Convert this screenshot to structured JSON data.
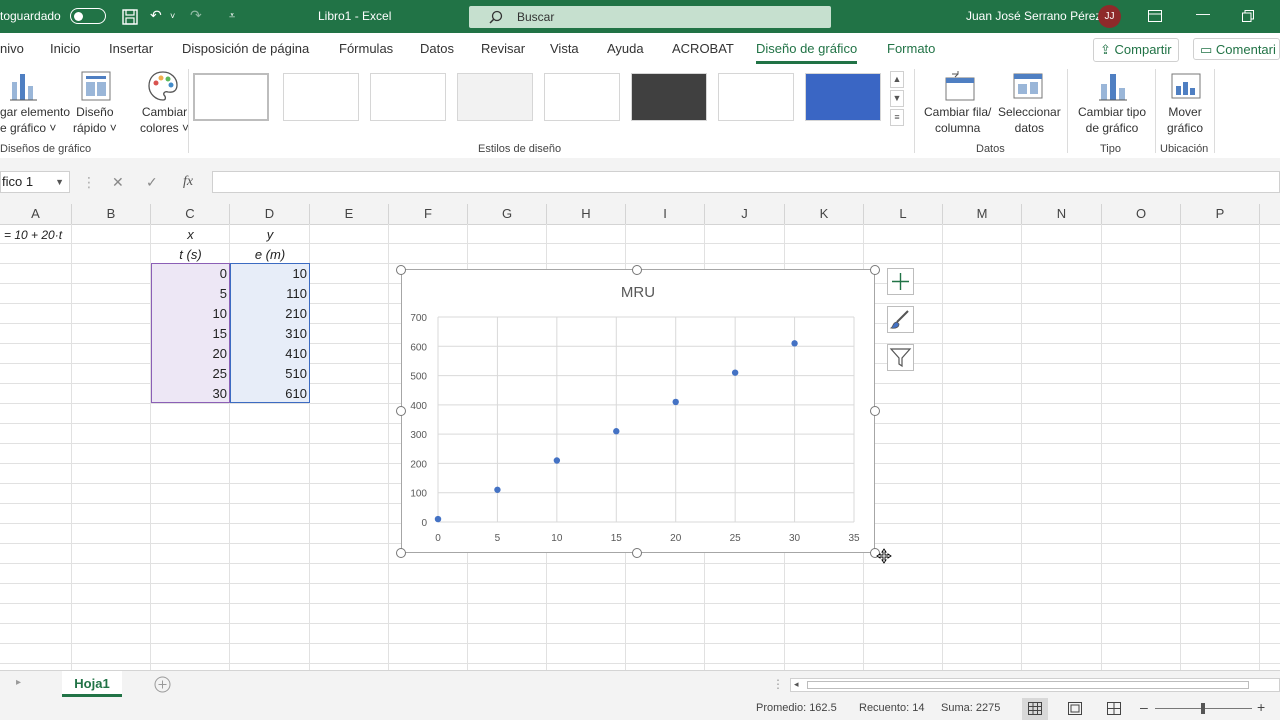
{
  "titlebar": {
    "autosave": "toguardado",
    "doc_title": "Libro1  -  Excel",
    "search_placeholder": "Buscar",
    "user_name": "Juan José Serrano Pérez",
    "user_initials": "JJ"
  },
  "tabs": [
    {
      "label": "nivo"
    },
    {
      "label": "Inicio"
    },
    {
      "label": "Insertar"
    },
    {
      "label": "Disposición de página"
    },
    {
      "label": "Fórmulas"
    },
    {
      "label": "Datos"
    },
    {
      "label": "Revisar"
    },
    {
      "label": "Vista"
    },
    {
      "label": "Ayuda"
    },
    {
      "label": "ACROBAT"
    },
    {
      "label": "Diseño de gráfico"
    },
    {
      "label": "Formato"
    }
  ],
  "share": {
    "label": "Compartir"
  },
  "comments": {
    "label": "Comentari"
  },
  "ribbon": {
    "add_element": "gar elemento\ne gráfico ˅",
    "quick_layout": "Diseño\nrápido ˅",
    "change_colors": "Cambiar\ncolores ˅",
    "group_layouts": "Diseños de gráfico",
    "group_styles": "Estilos de diseño",
    "switch_row_col": "Cambiar fila/\ncolumna",
    "select_data": "Seleccionar\ndatos",
    "group_data": "Datos",
    "change_type": "Cambiar tipo\nde gráfico",
    "group_type": "Tipo",
    "move_chart": "Mover\ngráfico",
    "group_location": "Ubicación"
  },
  "formula_bar": {
    "name_box": "fico 1",
    "fx": "fx",
    "value": ""
  },
  "columns": [
    "A",
    "B",
    "C",
    "D",
    "E",
    "F",
    "G",
    "H",
    "I",
    "J",
    "K",
    "L",
    "M",
    "N",
    "O",
    "P"
  ],
  "cells": {
    "a1": "= 10 + 20·t",
    "c1": "x",
    "d1": "y",
    "c2": "t (s)",
    "d2": "e (m)",
    "t_values": [
      "0",
      "5",
      "10",
      "15",
      "20",
      "25",
      "30"
    ],
    "e_values": [
      "10",
      "110",
      "210",
      "310",
      "410",
      "510",
      "610"
    ]
  },
  "sheet": {
    "tab": "Hoja1"
  },
  "status": {
    "average": "Promedio: 162.5",
    "count": "Recuento: 14",
    "sum": "Suma: 2275"
  },
  "colors": {
    "excel_green": "#217346",
    "series": "#4472c4"
  },
  "icons": [
    "save-icon",
    "undo-icon",
    "redo-icon",
    "customize-icon",
    "search-icon",
    "ribbon-display-icon",
    "minimize-icon",
    "restore-icon",
    "add-element-icon",
    "quick-layout-icon",
    "palette-icon",
    "switch-row-col-icon",
    "select-data-icon",
    "change-type-icon",
    "move-chart-icon",
    "cancel-icon",
    "enter-icon",
    "plus-icon",
    "brush-icon",
    "filter-icon",
    "add-sheet-icon",
    "normal-view-icon",
    "page-layout-icon",
    "page-break-icon",
    "move-cursor-icon"
  ],
  "chart_data": {
    "type": "scatter",
    "title": "MRU",
    "x": [
      0,
      5,
      10,
      15,
      20,
      25,
      30
    ],
    "y": [
      10,
      110,
      210,
      310,
      410,
      510,
      610
    ],
    "xlim": [
      0,
      35
    ],
    "ylim": [
      0,
      700
    ],
    "xticks": [
      0,
      5,
      10,
      15,
      20,
      25,
      30,
      35
    ],
    "yticks": [
      0,
      100,
      200,
      300,
      400,
      500,
      600,
      700
    ],
    "xlabel": "",
    "ylabel": "",
    "grid": true,
    "legend": "none"
  }
}
